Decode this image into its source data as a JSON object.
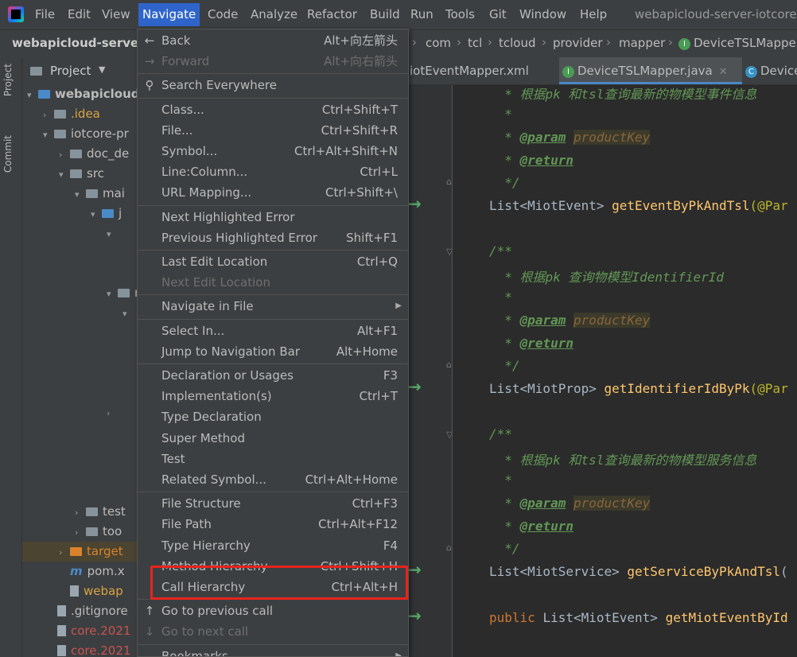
{
  "menubar": {
    "items": [
      "File",
      "Edit",
      "View",
      "Navigate",
      "Code",
      "Analyze",
      "Refactor",
      "Build",
      "Run",
      "Tools",
      "Git",
      "Window",
      "Help"
    ],
    "active": "Navigate",
    "window_title": "webapicloud-server-iotcore"
  },
  "navbar": {
    "project_name": "webapicloud-server-",
    "breadcrumbs": [
      "com",
      "tcl",
      "tcloud",
      "provider",
      "mapper",
      "DeviceTSLMapper"
    ]
  },
  "stripe": {
    "project_tab": "Project",
    "commit_tab": "Commit"
  },
  "project_panel": {
    "title": "Project",
    "rows": [
      {
        "arrow": "▾",
        "icon": "folder-blue",
        "label": "webapicloud",
        "bold": true
      },
      {
        "arrow": "›",
        "icon": "folder",
        "label": ".idea",
        "color": "#d9a343"
      },
      {
        "arrow": "▾",
        "icon": "folder",
        "label": "iotcore-pr"
      },
      {
        "arrow": "›",
        "icon": "folder",
        "label": "doc_de"
      },
      {
        "arrow": "▾",
        "icon": "folder",
        "label": "src"
      },
      {
        "arrow": "▾",
        "icon": "folder",
        "label": "mai"
      },
      {
        "arrow": "▾",
        "icon": "folder-blue",
        "label": "j"
      },
      {
        "arrow": "▾",
        "icon": "",
        "label": ""
      },
      {
        "arrow": "▾",
        "icon": "folder",
        "label": "r"
      },
      {
        "arrow": "▾",
        "icon": "",
        "label": ""
      },
      {
        "arrow": "›",
        "icon": "",
        "label": ""
      },
      {
        "arrow": "›",
        "icon": "folder",
        "label": "test"
      },
      {
        "arrow": "›",
        "icon": "folder",
        "label": "too"
      },
      {
        "arrow": "›",
        "icon": "folder-orange",
        "label": "target",
        "color": "#d9822b"
      },
      {
        "arrow": "",
        "icon": "maven",
        "label": "pom.x"
      },
      {
        "arrow": "",
        "icon": "file",
        "label": "webap",
        "color": "#d9a343"
      },
      {
        "arrow": "",
        "icon": "file",
        "label": ".gitignore"
      },
      {
        "arrow": "",
        "icon": "file",
        "label": "core.2021",
        "color": "#c75450"
      },
      {
        "arrow": "",
        "icon": "file",
        "label": "core.2021",
        "color": "#c75450"
      }
    ]
  },
  "tabs": [
    {
      "label": "iotEventMapper.xml",
      "active": false
    },
    {
      "label": "DeviceTSLMapper.java",
      "active": true
    },
    {
      "label": "Device",
      "active": false
    }
  ],
  "code": {
    "doc1_line": "* 根据pk 和tsl查询最新的物模型事件信息",
    "doc2_line": "* 根据pk 查询物模型IdentifierId",
    "doc3_line": "* 根据pk 和tsl查询最新的物模型服务信息",
    "param_tag": "@param",
    "param_name": "productKey",
    "return_tag": "@return",
    "doc_open": "/**",
    "doc_close": "*/",
    "star": "*",
    "sig1_type": "List<MiotEvent> ",
    "sig1_fn": "getEventByPkAndTsl",
    "sig1_rest": "(@Par",
    "sig2_type": "List<MiotProp> ",
    "sig2_fn": "getIdentifierIdByPk",
    "sig2_rest": "(@Par",
    "sig3_type": "List<MiotService> ",
    "sig3_fn": "getServiceByPkAndTsl",
    "sig3_rest": "(",
    "sig4_kw": "public ",
    "sig4_type": "List<MiotEvent> ",
    "sig4_fn": "getMiotEventById"
  },
  "navigate_menu": [
    {
      "label": "Back",
      "shortcut": "Alt+向左箭头",
      "icon": "←",
      "disabled": false
    },
    {
      "label": "Forward",
      "shortcut": "Alt+向右箭头",
      "icon": "→",
      "disabled": true
    },
    {
      "sep": true
    },
    {
      "label": "Search Everywhere",
      "shortcut": "",
      "icon": "⚲",
      "disabled": false
    },
    {
      "sep": true
    },
    {
      "label": "Class...",
      "shortcut": "Ctrl+Shift+T",
      "disabled": false
    },
    {
      "label": "File...",
      "shortcut": "Ctrl+Shift+R",
      "disabled": false
    },
    {
      "label": "Symbol...",
      "shortcut": "Ctrl+Alt+Shift+N",
      "disabled": false
    },
    {
      "label": "Line:Column...",
      "shortcut": "Ctrl+L",
      "disabled": false
    },
    {
      "label": "URL Mapping...",
      "shortcut": "Ctrl+Shift+\\",
      "disabled": false
    },
    {
      "sep": true
    },
    {
      "label": "Next Highlighted Error",
      "shortcut": "",
      "disabled": false
    },
    {
      "label": "Previous Highlighted Error",
      "shortcut": "Shift+F1",
      "disabled": false
    },
    {
      "sep": true
    },
    {
      "label": "Last Edit Location",
      "shortcut": "Ctrl+Q",
      "disabled": false
    },
    {
      "label": "Next Edit Location",
      "shortcut": "",
      "disabled": true
    },
    {
      "sep": true
    },
    {
      "label": "Navigate in File",
      "shortcut": "",
      "submenu": true,
      "disabled": false
    },
    {
      "sep": true
    },
    {
      "label": "Select In...",
      "shortcut": "Alt+F1",
      "disabled": false
    },
    {
      "label": "Jump to Navigation Bar",
      "shortcut": "Alt+Home",
      "disabled": false
    },
    {
      "sep": true
    },
    {
      "label": "Declaration or Usages",
      "shortcut": "F3",
      "disabled": false
    },
    {
      "label": "Implementation(s)",
      "shortcut": "Ctrl+T",
      "disabled": false
    },
    {
      "label": "Type Declaration",
      "shortcut": "",
      "disabled": false
    },
    {
      "label": "Super Method",
      "shortcut": "",
      "disabled": false
    },
    {
      "label": "Test",
      "shortcut": "",
      "disabled": false
    },
    {
      "label": "Related Symbol...",
      "shortcut": "Ctrl+Alt+Home",
      "disabled": false
    },
    {
      "sep": true
    },
    {
      "label": "File Structure",
      "shortcut": "Ctrl+F3",
      "disabled": false
    },
    {
      "label": "File Path",
      "shortcut": "Ctrl+Alt+F12",
      "disabled": false
    },
    {
      "label": "Type Hierarchy",
      "shortcut": "F4",
      "disabled": false
    },
    {
      "label": "Method Hierarchy",
      "shortcut": "Ctrl+Shift+H",
      "disabled": false
    },
    {
      "label": "Call Hierarchy",
      "shortcut": "Ctrl+Alt+H",
      "disabled": false
    },
    {
      "sep": true
    },
    {
      "label": "Go to previous call",
      "shortcut": "",
      "icon": "↑",
      "disabled": false
    },
    {
      "label": "Go to next call",
      "shortcut": "",
      "icon": "↓",
      "disabled": true
    },
    {
      "sep": true
    },
    {
      "label": "Bookmarks",
      "shortcut": "",
      "submenu": true,
      "disabled": false
    }
  ],
  "colors": {
    "accent": "#2f65ca",
    "highlight_box": "#e8231c",
    "menu_bg": "#3c3f41"
  }
}
